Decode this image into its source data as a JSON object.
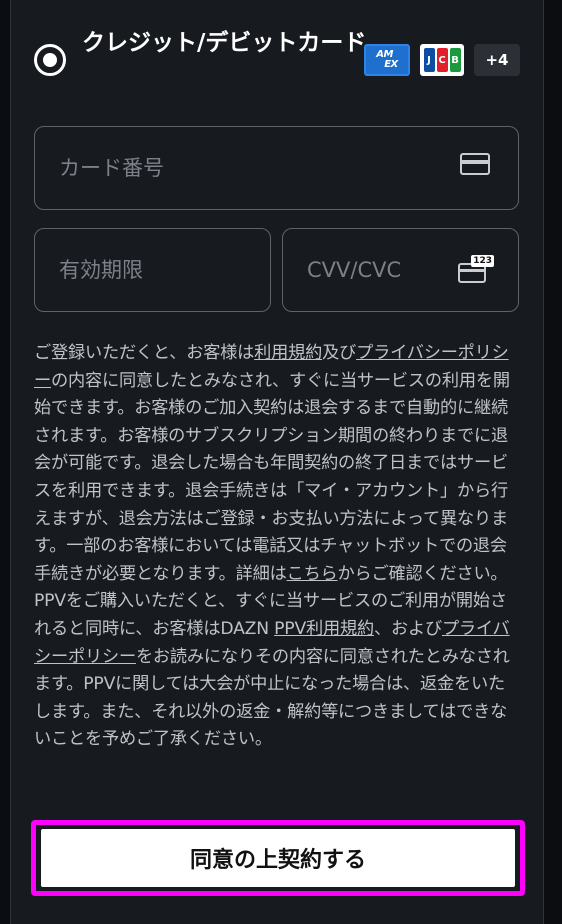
{
  "payment_method": {
    "label": "クレジット/デビットカード",
    "selected": true,
    "brands": {
      "amex_line1": "AM",
      "amex_line2": "EX",
      "jcb_letters": [
        "J",
        "C",
        "B"
      ],
      "more": "+4"
    },
    "icons": {
      "radio": "radio-selected-icon",
      "card": "credit-card-icon",
      "cvv": "card-cvv-icon"
    }
  },
  "fields": {
    "card_number_placeholder": "カード番号",
    "expiry_placeholder": "有効期限",
    "cvv_placeholder": "CVV/CVC",
    "cvv_badge": "123"
  },
  "terms": {
    "p1_a": "ご登録いただくと、お客様は",
    "link_terms": "利用規約",
    "p1_b": "及び",
    "link_privacy": "プライバシーポリシー",
    "p1_c": "の内容に同意したとみなされ、すぐに当サービスの利用を開始できます。お客様のご加入契約は退会するまで自動的に継続されます。お客様のサブスクリプション期間の終わりまでに退会が可能です。退会した場合も年間契約の終了日まではサービスを利用できます。退会手続きは「マイ・アカウント」から行えますが、退会方法はご登録・お支払い方法によって異なります。一部のお客様においては電話又はチャットボットでの退会手続きが必要となります。詳細は",
    "link_here": "こちら",
    "p1_d": "からご確認ください。",
    "p2_a": "PPVをご購入いただくと、すぐに当サービスのご利用が開始されると同時に、お客様はDAZN ",
    "link_ppv_terms": "PPV利用規約",
    "p2_b": "、および",
    "link_privacy2": "プライバシーポリシー",
    "p2_c": "をお読みになりその内容に同意されたとみなされます。PPVに関しては大会が中止になった場合は、返金をいたします。また、それ以外の返金・解約等につきましてはできないことを予めご了承ください。"
  },
  "agree_button_label": "同意の上契約する",
  "colors": {
    "background": "#171a1f",
    "highlight": "#ff00ff",
    "button": "#ffffff"
  }
}
